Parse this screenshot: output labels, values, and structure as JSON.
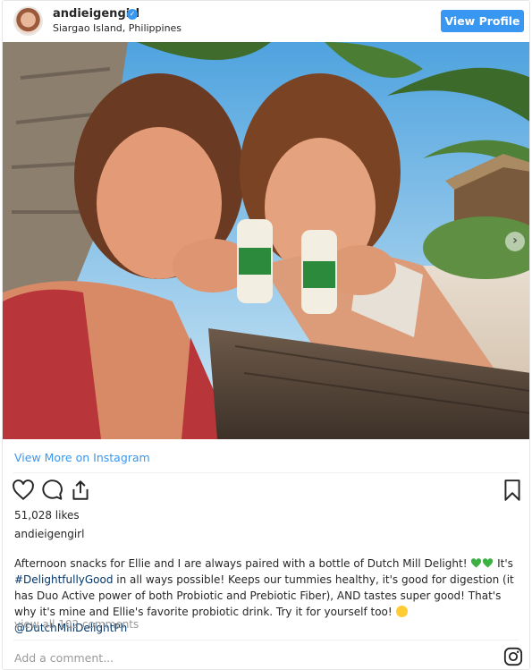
{
  "header": {
    "username": "andieigengirl",
    "location": "Siargao Island, Philippines",
    "view_profile_label": "View Profile"
  },
  "post": {
    "view_more_label": "View More on Instagram",
    "likes": "51,028 likes",
    "owner": "andieigengirl",
    "caption": {
      "part1": "Afternoon snacks for Ellie and I are always paired with a bottle of Dutch Mill Delight! ",
      "part2": " It's ",
      "hashtag": "#DelightfullyGood",
      "part3": " in all ways possible! Keeps our tummies healthy, it's good for digestion (it has Duo Active power of both Probiotic and Prebiotic Fiber), AND tastes super good! That's why it's mine and Ellie's favorite probiotic drink. Try it for yourself too! ",
      "mention": "@DutchMillDelightPh"
    },
    "view_all_comments": "view all 102 comments",
    "add_comment_placeholder": "Add a comment..."
  },
  "icons": [
    "verified-badge-icon",
    "next-arrow-icon",
    "heart-icon",
    "comment-icon",
    "share-icon",
    "bookmark-icon",
    "instagram-logo-icon",
    "green-heart-emoji",
    "yum-emoji"
  ],
  "colors": {
    "accent": "#3897f0",
    "link": "#003569",
    "muted": "#999999"
  }
}
